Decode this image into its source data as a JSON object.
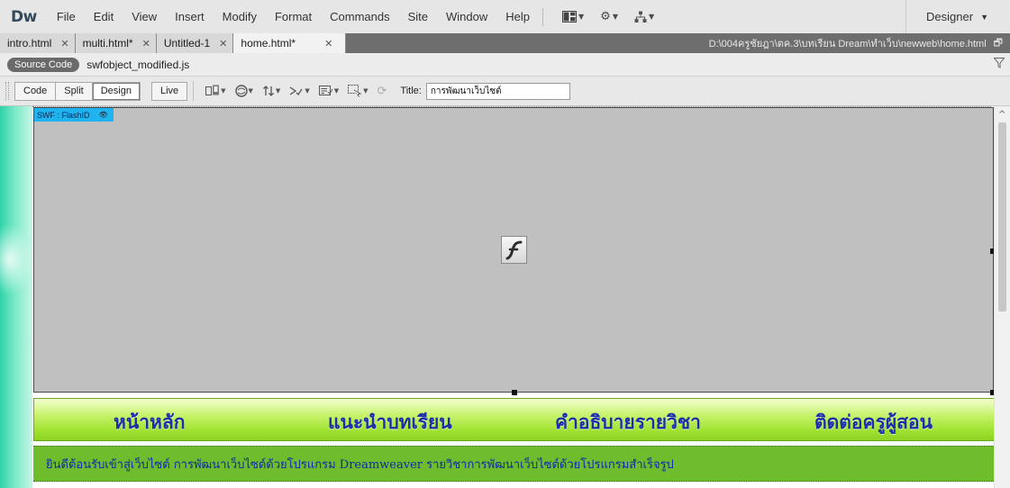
{
  "app": {
    "logo": "Dw",
    "menu": [
      "File",
      "Edit",
      "View",
      "Insert",
      "Modify",
      "Format",
      "Commands",
      "Site",
      "Window",
      "Help"
    ],
    "workspace": "Designer"
  },
  "tabs": [
    {
      "label": "intro.html"
    },
    {
      "label": "multi.html*"
    },
    {
      "label": "Untitled-1"
    },
    {
      "label": "home.html*",
      "active": true
    }
  ],
  "file_path": "D:\\004ครูชัยฎา\\ตค.3\\บทเรียน Dream\\ทำเว็บ\\newweb\\home.html",
  "related_files": {
    "source_code": "Source Code",
    "file": "swfobject_modified.js"
  },
  "doc_toolbar": {
    "views": [
      "Code",
      "Split",
      "Design",
      "Live"
    ],
    "active_view": "Design",
    "title_label": "Title:",
    "title_value": "การพัฒนาเว็บไซต์"
  },
  "design_view": {
    "swf_label": "SWF : FlashID",
    "nav": [
      "หน้าหลัก",
      "แนะนำบทเรียน",
      "คำอธิบายรายวิชา",
      "ติดต่อครูผู้สอน"
    ],
    "welcome": "ยินดีต้อนรับเข้าสู่เว็บไซต์ การพัฒนาเว็บไซต์ด้วยโปรแกรม Dreamweaver รายวิชาการพัฒนาเว็บไซต์ด้วยโปรแกรมสำเร็จรูป"
  },
  "colors": {
    "swf_tag": "#1fb3f0",
    "nav_text": "#1c2fa8",
    "nav_green": "#a2e334",
    "welcome_bg": "#6fbd2c"
  }
}
